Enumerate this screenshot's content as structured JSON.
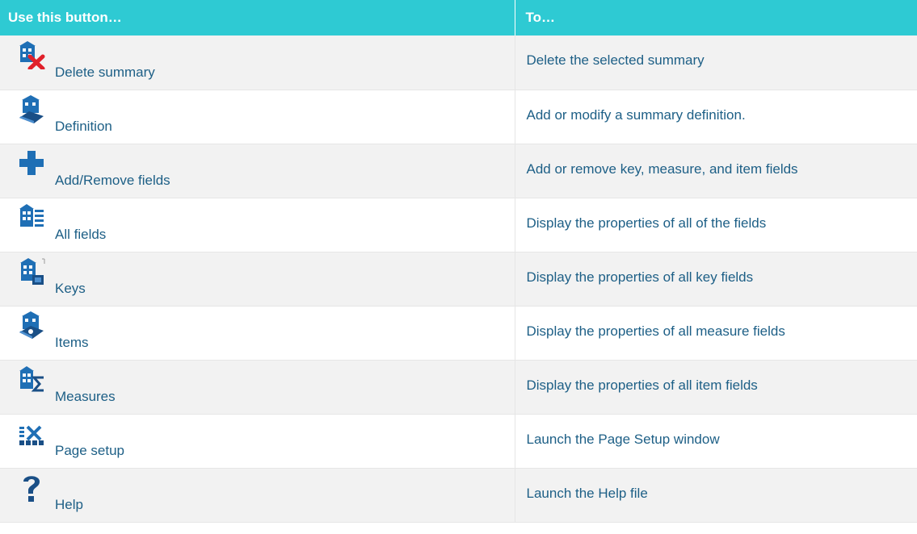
{
  "header": {
    "col1": "Use this button…",
    "col2": "To…"
  },
  "colors": {
    "header_bg": "#2ecad3",
    "text": "#1d5f86",
    "icon_blue": "#1f6fb5",
    "delete_red": "#e0202a"
  },
  "rows": [
    {
      "icon": "delete-summary-icon",
      "button": "Delete summary",
      "action": "Delete the selected summary"
    },
    {
      "icon": "definition-icon",
      "button": "Definition",
      "action": "Add or modify a summary definition."
    },
    {
      "icon": "plus-icon",
      "button": "Add/Remove fields",
      "action": "Add or remove key, measure, and item fields"
    },
    {
      "icon": "all-fields-icon",
      "button": "All fields",
      "action": "Display the properties of all of the fields"
    },
    {
      "icon": "keys-icon",
      "button": "Keys",
      "action": "Display the properties of all key fields"
    },
    {
      "icon": "items-icon",
      "button": "Items",
      "action": "Display the properties of all measure fields"
    },
    {
      "icon": "measures-icon",
      "button": "Measures",
      "action": "Display the properties of all item fields"
    },
    {
      "icon": "page-setup-icon",
      "button": "Page setup",
      "action": "Launch the Page Setup window"
    },
    {
      "icon": "help-icon",
      "button": "Help",
      "action": "Launch the Help file"
    }
  ]
}
